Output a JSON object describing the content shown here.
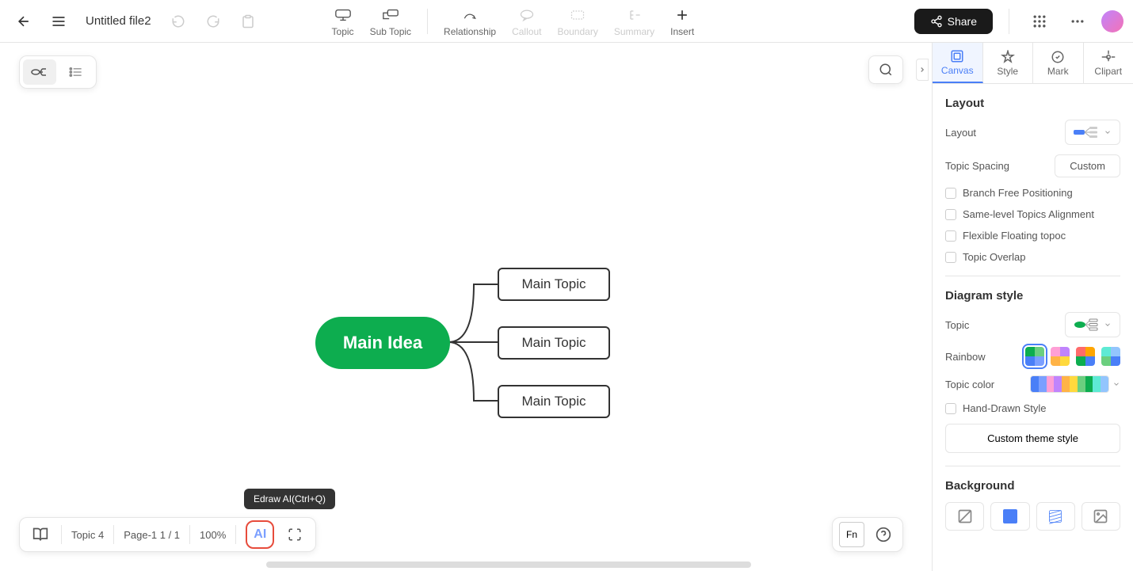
{
  "header": {
    "file_name": "Untitled file2",
    "tools": {
      "topic": "Topic",
      "sub_topic": "Sub Topic",
      "relationship": "Relationship",
      "callout": "Callout",
      "boundary": "Boundary",
      "summary": "Summary",
      "insert": "Insert"
    },
    "share": "Share"
  },
  "mind_map": {
    "main_idea": "Main Idea",
    "topics": [
      "Main Topic",
      "Main Topic",
      "Main Topic"
    ]
  },
  "right_panel": {
    "tabs": {
      "canvas": "Canvas",
      "style": "Style",
      "mark": "Mark",
      "clipart": "Clipart"
    },
    "layout": {
      "title": "Layout",
      "layout_label": "Layout",
      "spacing_label": "Topic Spacing",
      "custom_btn": "Custom",
      "branch_free": "Branch Free Positioning",
      "same_level": "Same-level Topics Alignment",
      "flexible": "Flexible Floating topoc",
      "overlap": "Topic Overlap"
    },
    "diagram_style": {
      "title": "Diagram style",
      "topic_label": "Topic",
      "rainbow_label": "Rainbow",
      "topic_color_label": "Topic color",
      "hand_drawn": "Hand-Drawn Style",
      "custom_theme": "Custom theme style"
    },
    "background": {
      "title": "Background"
    },
    "colors": {
      "rainbow_palette": [
        "#0dad4f",
        "#ffa500",
        "#ff6b6b",
        "#4a7ff7"
      ],
      "topic_colors": [
        "#4a7ff7",
        "#7b9fff",
        "#ff9fd6",
        "#c084fc",
        "#ffb347",
        "#ffd93d",
        "#6bcf7f",
        "#0dad4f",
        "#5eead4",
        "#93c5fd"
      ]
    }
  },
  "bottom_bar": {
    "topic_count": "Topic 4",
    "page_info": "Page-1  1 / 1",
    "zoom": "100%",
    "ai_label": "AI",
    "tooltip": "Edraw AI(Ctrl+Q)",
    "fn_label": "Fn"
  },
  "chart_data": {
    "type": "mindmap",
    "root": "Main Idea",
    "children": [
      "Main Topic",
      "Main Topic",
      "Main Topic"
    ],
    "layout": "right-tree",
    "root_color": "#0dad4f"
  }
}
